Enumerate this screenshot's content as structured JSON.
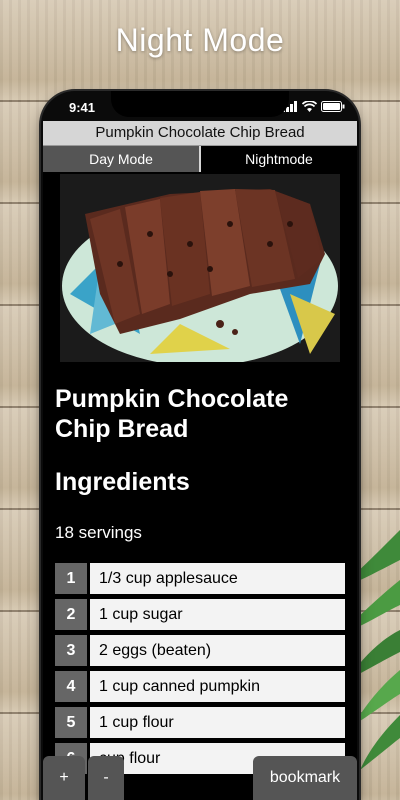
{
  "banner": {
    "title": "Night Mode"
  },
  "status_bar": {
    "time": "9:41"
  },
  "app": {
    "title": "Pumpkin Chocolate Chip Bread"
  },
  "tabs": [
    {
      "label": "Day Mode"
    },
    {
      "label": "Nightmode"
    }
  ],
  "recipe": {
    "name": "Pumpkin Chocolate Chip Bread",
    "ingredients_heading": "Ingredients",
    "servings": "18 servings",
    "ingredients": [
      {
        "num": "1",
        "text": "1/3 cup applesauce"
      },
      {
        "num": "2",
        "text": "1 cup sugar"
      },
      {
        "num": "3",
        "text": "2 eggs (beaten)"
      },
      {
        "num": "4",
        "text": "1 cup canned pumpkin"
      },
      {
        "num": "5",
        "text": "1 cup flour"
      },
      {
        "num": "6",
        "text": "cup flour"
      }
    ]
  },
  "controls": {
    "plus": "+",
    "minus": "-",
    "bookmark": "bookmark"
  }
}
